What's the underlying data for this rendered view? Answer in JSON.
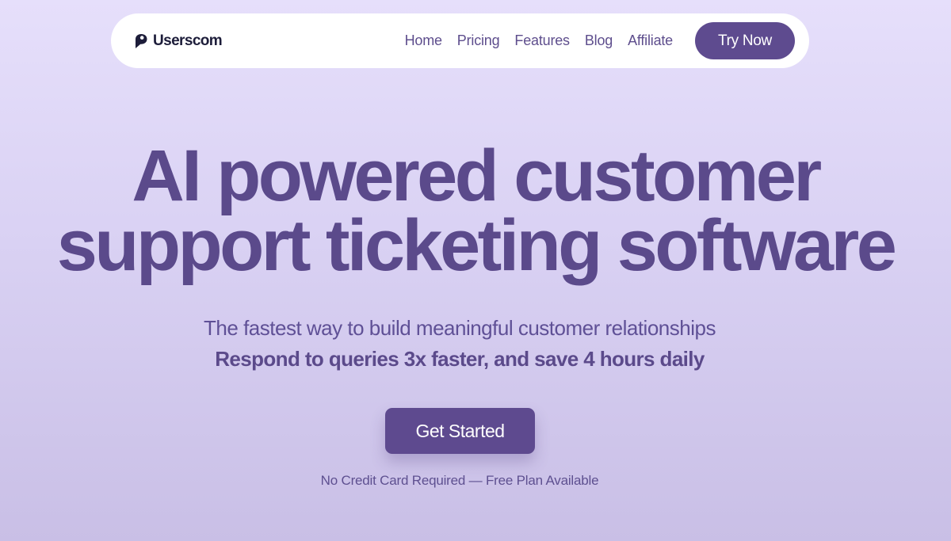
{
  "nav": {
    "logo_text": "Userscom",
    "links": [
      "Home",
      "Pricing",
      "Features",
      "Blog",
      "Affiliate"
    ],
    "cta_label": "Try Now"
  },
  "hero": {
    "title_line1": "AI powered customer",
    "title_line2": "support ticketing software",
    "subtitle": "The fastest way to build meaningful customer relationships",
    "subtitle_strong": "Respond to queries 3x faster, and save 4 hours daily",
    "cta_label": "Get Started",
    "note": "No Credit Card Required — Free Plan Available"
  },
  "colors": {
    "brand": "#5e4b8f",
    "text": "#5b4a8b",
    "logo_text": "#1d1d3a",
    "background_top": "#e6dffb",
    "background_bottom": "#c9bfe6"
  },
  "icons": {
    "logo": "chat-bubble-logo-icon"
  }
}
